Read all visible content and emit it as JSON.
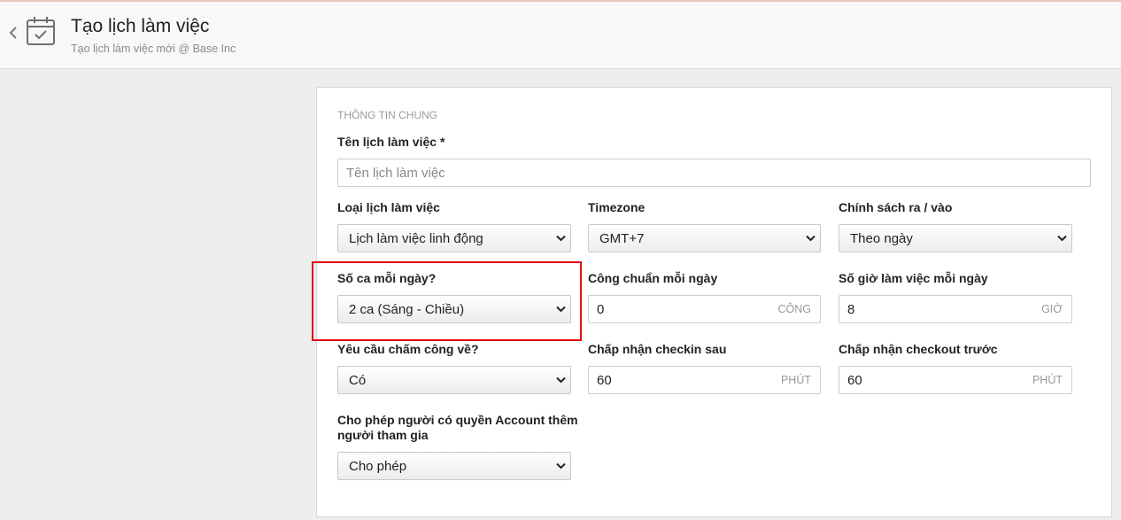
{
  "header": {
    "title": "Tạo lịch làm việc",
    "subtitle": "Tạo lịch làm việc mới @ Base Inc"
  },
  "form": {
    "section_title": "THÔNG TIN CHUNG",
    "name": {
      "label": "Tên lịch làm việc *",
      "placeholder": "Tên lịch làm việc",
      "value": ""
    },
    "schedule_type": {
      "label": "Loại lịch làm việc",
      "value": "Lịch làm việc linh động"
    },
    "timezone": {
      "label": "Timezone",
      "value": "GMT+7"
    },
    "inout_policy": {
      "label": "Chính sách ra / vào",
      "value": "Theo ngày"
    },
    "shifts_per_day": {
      "label": "Số ca mỗi ngày?",
      "value": "2 ca (Sáng - Chiều)"
    },
    "standard_workday": {
      "label": "Công chuẩn mỗi ngày",
      "value": "0",
      "unit": "CÔNG"
    },
    "hours_per_day": {
      "label": "Số giờ làm việc mỗi ngày",
      "value": "8",
      "unit": "GIỜ"
    },
    "require_checkout": {
      "label": "Yêu cầu chấm công về?",
      "value": "Có"
    },
    "checkin_after": {
      "label": "Chấp nhận checkin sau",
      "value": "60",
      "unit": "PHÚT"
    },
    "checkout_before": {
      "label": "Chấp nhận checkout trước",
      "value": "60",
      "unit": "PHÚT"
    },
    "allow_account_add": {
      "label_line1": "Cho phép người có quyền Account thêm",
      "label_line2": "người tham gia",
      "value": "Cho phép"
    }
  },
  "colors": {
    "highlight_border": "#e01010",
    "page_background": "#eeeeee",
    "card_background": "#ffffff"
  },
  "icons": [
    "chevron-left-icon",
    "calendar-check-icon",
    "chevron-down-icon"
  ]
}
